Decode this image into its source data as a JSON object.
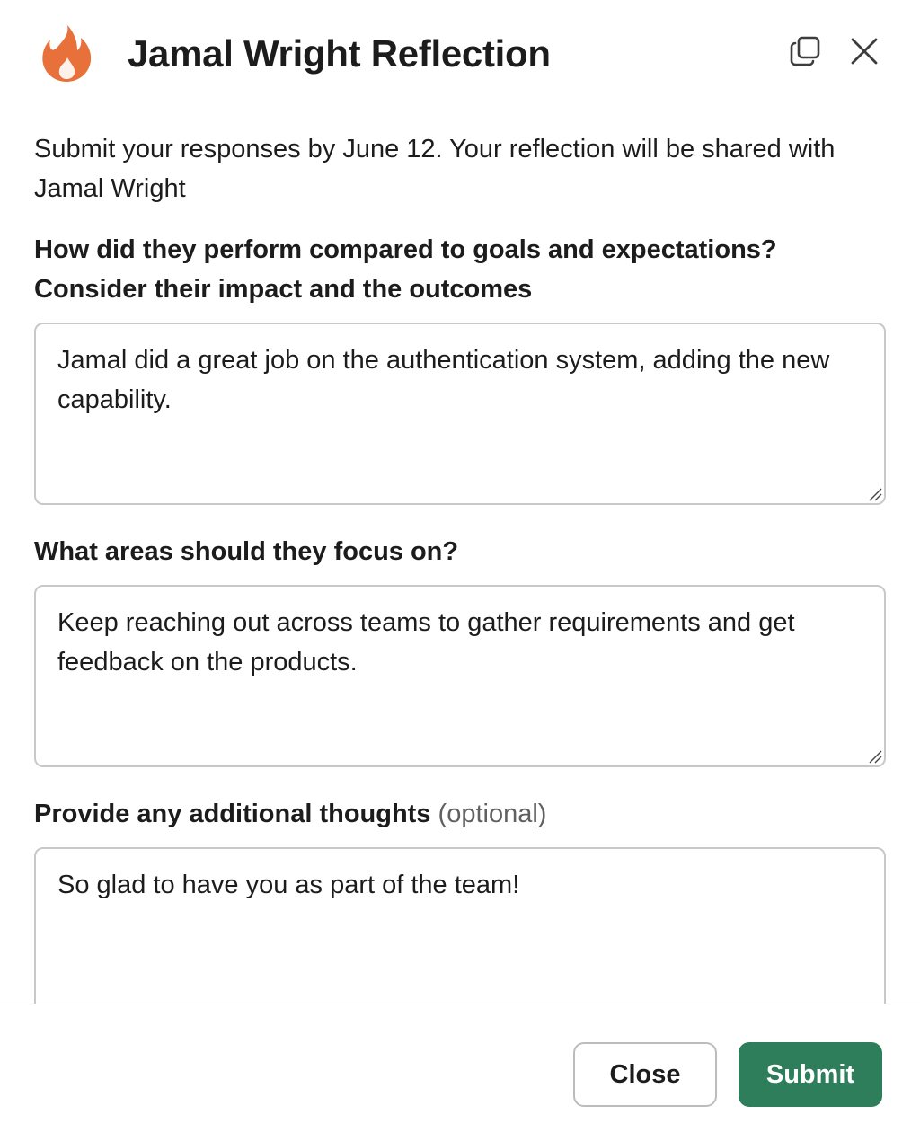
{
  "header": {
    "title": "Jamal Wright Reflection",
    "icons": {
      "app": "flame-icon",
      "popout": "popout-window-icon",
      "close": "close-icon"
    }
  },
  "intro": "Submit your responses by June 12. Your reflection will be shared with Jamal Wright",
  "questions": [
    {
      "label": "How did they perform compared to goals and expectations? Consider their impact and the outcomes",
      "value": "Jamal did a great job on the authentication system, adding the new capability."
    },
    {
      "label": "What areas should they focus on?",
      "value": "Keep reaching out across teams to gather requirements and get feedback on the products."
    },
    {
      "label": "Provide any additional thoughts",
      "optional": "(optional)",
      "value": "So glad to have you as part of the team!"
    }
  ],
  "footer": {
    "close_label": "Close",
    "submit_label": "Submit"
  },
  "colors": {
    "flame": "#e8703a",
    "submit": "#2e7d5b",
    "text": "#1d1c1d"
  }
}
